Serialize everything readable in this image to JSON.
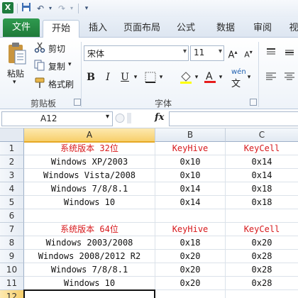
{
  "app": {
    "icon_letter": "X",
    "accent": "#1e7b3e"
  },
  "tabs": [
    "文件",
    "开始",
    "插入",
    "页面布局",
    "公式",
    "数据",
    "审阅",
    "视"
  ],
  "clipboard": {
    "paste": "粘贴",
    "cut": "剪切",
    "copy": "复制",
    "format_painter": "格式刷",
    "group": "剪贴板"
  },
  "font": {
    "name": "宋体",
    "size": "11",
    "group": "字体",
    "bold": "B",
    "italic": "I",
    "underline": "U",
    "phonetic": "wén"
  },
  "formula_bar": {
    "name_box": "A12",
    "fx": "fx",
    "value": ""
  },
  "grid": {
    "columns": [
      "A",
      "B",
      "C"
    ],
    "rows": [
      "1",
      "2",
      "3",
      "4",
      "5",
      "6",
      "7",
      "8",
      "9",
      "10",
      "11",
      "12"
    ],
    "cells": [
      [
        "系统版本 32位",
        "KeyHive",
        "KeyCell"
      ],
      [
        "Windows XP/2003",
        "0x10",
        "0x14"
      ],
      [
        "Windows Vista/2008",
        "0x10",
        "0x14"
      ],
      [
        "Windows 7/8/8.1",
        "0x14",
        "0x18"
      ],
      [
        "Windows 10",
        "0x14",
        "0x18"
      ],
      [
        "",
        "",
        ""
      ],
      [
        "系统版本 64位",
        "KeyHive",
        "KeyCell"
      ],
      [
        "Windows 2003/2008",
        "0x18",
        "0x20"
      ],
      [
        "Windows 2008/2012 R2",
        "0x20",
        "0x28"
      ],
      [
        "Windows 7/8/8.1",
        "0x20",
        "0x28"
      ],
      [
        "Windows 10",
        "0x20",
        "0x28"
      ],
      [
        "",
        "",
        ""
      ]
    ],
    "header_color": "#d7191c",
    "selected_cell": "A12"
  }
}
